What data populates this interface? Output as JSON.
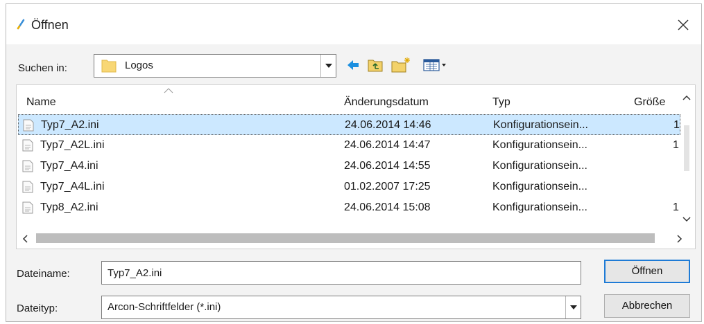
{
  "window": {
    "title": "Öffnen"
  },
  "lookin": {
    "label": "Suchen in:",
    "value": "Logos"
  },
  "columns": {
    "name": "Name",
    "date": "Änderungsdatum",
    "type": "Typ",
    "size": "Größe"
  },
  "files": [
    {
      "name": "Typ7_A2.ini",
      "date": "24.06.2014 14:46",
      "type": "Konfigurationsein...",
      "size": "1",
      "selected": true
    },
    {
      "name": "Typ7_A2L.ini",
      "date": "24.06.2014 14:47",
      "type": "Konfigurationsein...",
      "size": "1",
      "selected": false
    },
    {
      "name": "Typ7_A4.ini",
      "date": "24.06.2014 14:55",
      "type": "Konfigurationsein...",
      "size": "",
      "selected": false
    },
    {
      "name": "Typ7_A4L.ini",
      "date": "01.02.2007 17:25",
      "type": "Konfigurationsein...",
      "size": "",
      "selected": false
    },
    {
      "name": "Typ8_A2.ini",
      "date": "24.06.2014 15:08",
      "type": "Konfigurationsein...",
      "size": "1",
      "selected": false
    }
  ],
  "filename": {
    "label": "Dateiname:",
    "value": "Typ7_A2.ini"
  },
  "filetype": {
    "label": "Dateityp:",
    "value": "Arcon-Schriftfelder (*.ini)"
  },
  "buttons": {
    "open": "Öffnen",
    "cancel": "Abbrechen"
  },
  "colors": {
    "selection": "#cce8ff",
    "accent": "#1e7bd6",
    "folder": "#f8d775"
  }
}
